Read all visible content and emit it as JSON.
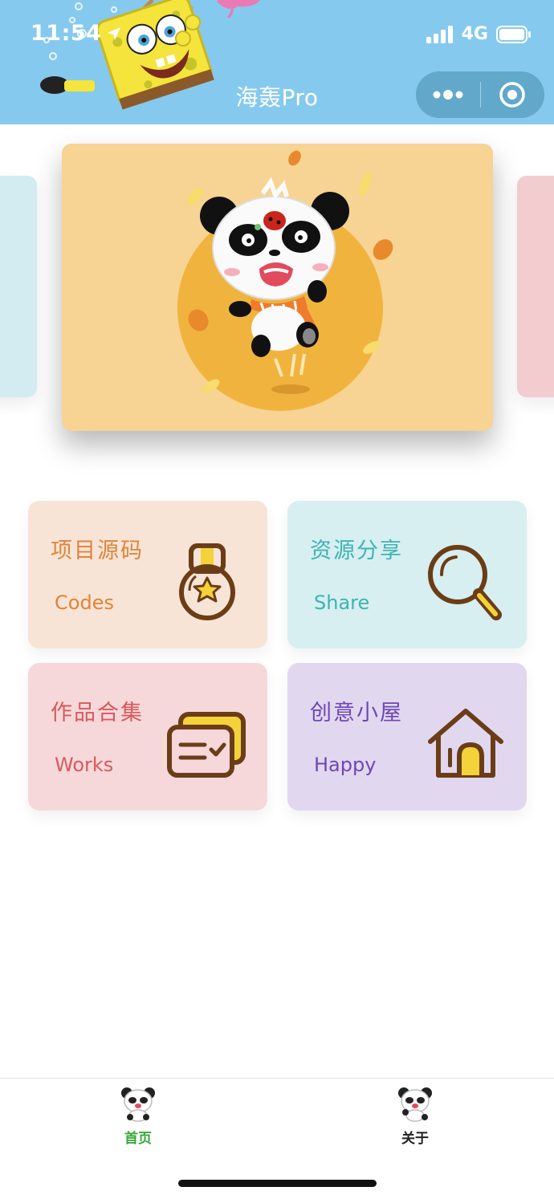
{
  "status_bar": {
    "time": "11:54",
    "network": "4G",
    "icons": [
      "location-arrow-icon",
      "signal-icon",
      "battery-icon"
    ]
  },
  "nav": {
    "title": "海轰Pro",
    "capsule_icons": [
      "more-dots-icon",
      "close-target-icon"
    ]
  },
  "carousel": {
    "active_index": 1,
    "slides": [
      {
        "bg": "#d3ecf1"
      },
      {
        "bg": "#f7d394",
        "image": "panda-autumn-illustration"
      },
      {
        "bg": "#f3ccd0"
      }
    ]
  },
  "menu": [
    {
      "cn": "项目源码",
      "en": "Codes",
      "icon": "medal-icon",
      "color": "#e0843a",
      "bg": "#f8e4d6"
    },
    {
      "cn": "资源分享",
      "en": "Share",
      "icon": "search-icon",
      "color": "#3fb3b3",
      "bg": "#d7eff0"
    },
    {
      "cn": "作品合集",
      "en": "Works",
      "icon": "cards-check-icon",
      "color": "#d85a5a",
      "bg": "#f6d8db"
    },
    {
      "cn": "创意小屋",
      "en": "Happy",
      "icon": "house-icon",
      "color": "#6f46b5",
      "bg": "#e1d8ef"
    }
  ],
  "tabbar": {
    "items": [
      {
        "label": "首页",
        "icon": "panda-icon",
        "active": true
      },
      {
        "label": "关于",
        "icon": "panda-icon",
        "active": false
      }
    ],
    "active_color": "#3aa83a"
  },
  "colors": {
    "header_bg": "#86c9ee"
  }
}
